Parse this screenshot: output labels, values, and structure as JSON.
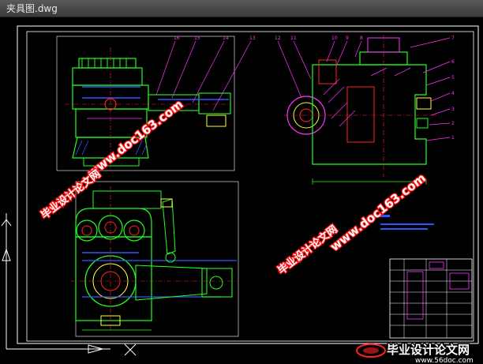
{
  "window": {
    "title": "夹具图.dwg"
  },
  "drawing": {
    "balloons_top": [
      "16",
      "15",
      "14",
      "13",
      "12",
      "11",
      "10",
      "9",
      "8"
    ],
    "balloons_right": [
      "1",
      "2",
      "3",
      "4",
      "5",
      "6",
      "7"
    ],
    "colors": {
      "frame": "#ffffff",
      "green": "#22ff22",
      "magenta": "#ff33ff",
      "cyan": "#00ffff",
      "blue": "#3355ff",
      "red": "#ff2222",
      "yellow": "#ffff33"
    }
  },
  "watermarks": {
    "site_cn": "毕业设计论文网",
    "site_url": "www.doc163.com",
    "logo_cn": "毕业设计论文网",
    "logo_url": "www.56doc.com"
  }
}
